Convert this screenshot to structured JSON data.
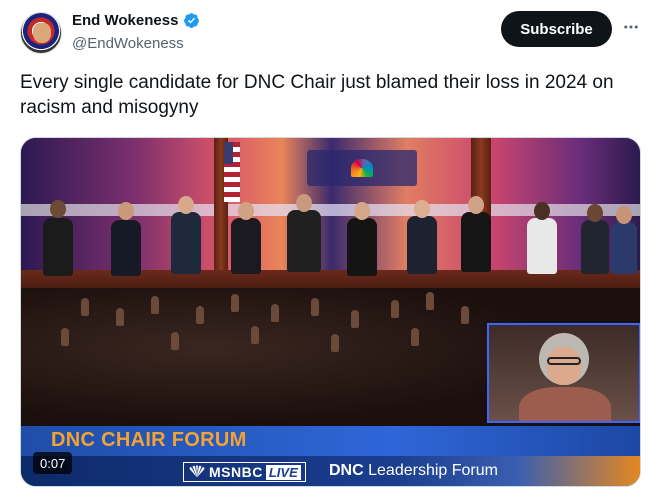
{
  "post": {
    "author": {
      "display_name": "End Wokeness",
      "handle": "@EndWokeness",
      "verified": true,
      "avatar_icon": "round-seal-avatar"
    },
    "subscribe_label": "Subscribe",
    "more_icon": "more-horizontal-icon",
    "text": "Every single candidate for DNC Chair just blamed their loss in 2024 on racism and misogyny"
  },
  "video": {
    "timestamp": "0:07",
    "lower_third_title": "DNC CHAIR FORUM",
    "network_logo": "MSNBC",
    "network_live": "LIVE",
    "program_bold": "DNC",
    "program_rest": " Leadership Forum",
    "colors": {
      "lower_third": "#2f66d8",
      "title_text": "#f4a234",
      "bar_accent": "#e7881e"
    }
  }
}
